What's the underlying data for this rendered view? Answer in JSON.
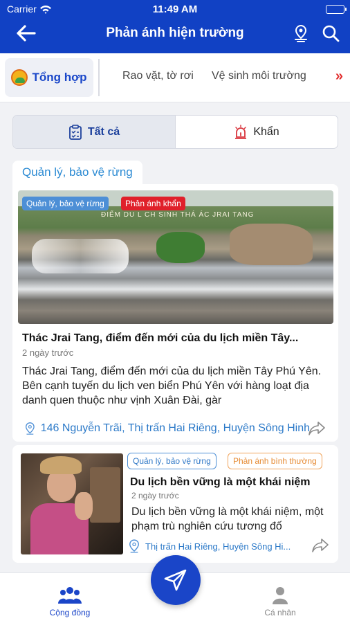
{
  "status_bar": {
    "carrier": "Carrier",
    "time": "11:49 AM"
  },
  "header": {
    "title": "Phản ánh hiện trường"
  },
  "category_tabs": {
    "active": "Tổng hợp",
    "items": [
      "Rao vặt, tờ rơi",
      "Vệ sinh môi trường"
    ],
    "more": "»"
  },
  "filter": {
    "all": "Tất cả",
    "urgent": "Khẩn"
  },
  "section": {
    "label": "Quản lý, bảo vệ rừng"
  },
  "posts": [
    {
      "category_tag": "Quản lý, bảo vệ rừng",
      "type_tag": "Phản ánh khẩn",
      "image_caption": "ĐIỂM DU L CH SINH THÁ  ÁC JRAI TANG",
      "title": "Thác Jrai Tang, điểm đến mới của du lịch miền Tây...",
      "time": "2 ngày trước",
      "description": "Thác Jrai Tang, điểm đến mới của du lịch miền Tây Phú Yên. Bên cạnh tuyến du lịch ven biển Phú Yên với hàng loạt địa danh quen thuộc như vịnh Xuân Đài, gàr",
      "address": "146 Nguyễn Trãi, Thị trấn Hai Riêng, Huyện Sông Hinh"
    },
    {
      "category_tag": "Quản lý, bảo vệ rừng",
      "type_tag": "Phản ánh bình thường",
      "title": "Du lịch bền vững là một khái niệm",
      "time": "2 ngày trước",
      "description": "Du lịch bền vững là một khái niệm, một phạm trù nghiên cứu tương đố",
      "address": "Thị trấn Hai Riêng, Huyện Sông Hi..."
    }
  ],
  "bottom_nav": {
    "community": "Cộng đồng",
    "personal": "Cá nhân"
  },
  "colors": {
    "primary": "#1141c4",
    "accent_red": "#e0202a",
    "link_blue": "#2b8ad3"
  }
}
